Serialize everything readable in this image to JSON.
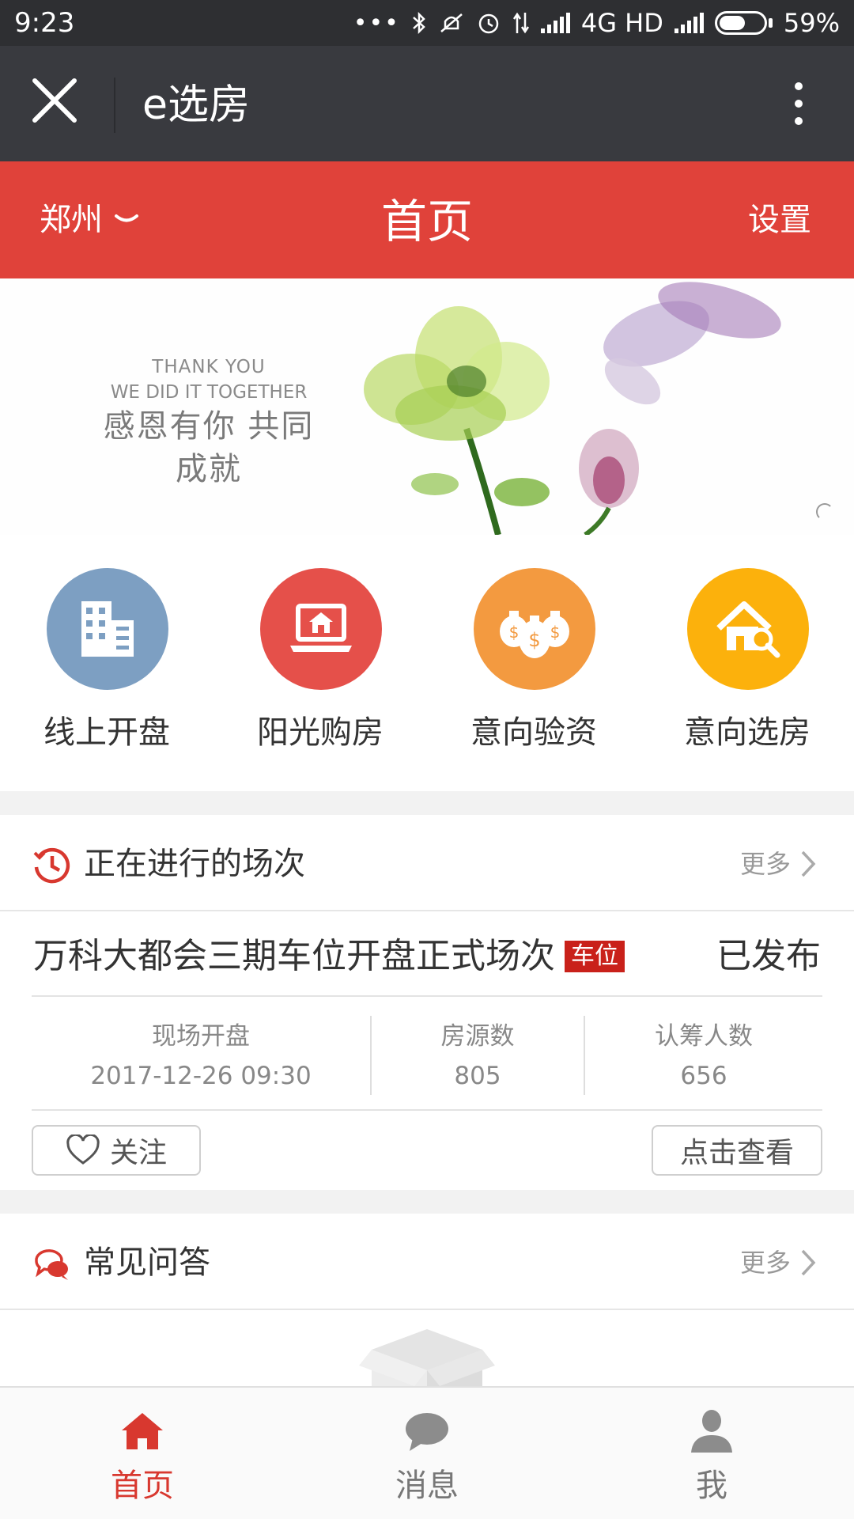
{
  "status_bar": {
    "time": "9:23",
    "network": "4G HD",
    "battery": "59%",
    "battery_level": 0.59,
    "icons": [
      "more-dots-icon",
      "bluetooth-icon",
      "mute-icon",
      "alarm-icon",
      "data-icon",
      "signal-icon",
      "signal-icon",
      "battery-icon"
    ]
  },
  "app_bar": {
    "title": "e选房",
    "icons": [
      "close-icon",
      "more-vertical-icon"
    ]
  },
  "header": {
    "city": "郑州",
    "title": "首页",
    "settings": "设置"
  },
  "banner": {
    "line1": "THANK YOU",
    "line2": "WE DID IT TOGETHER",
    "line3": "感恩有你  共同成就"
  },
  "actions": [
    {
      "label": "线上开盘",
      "icon": "building-icon",
      "color": "#7d9fc2"
    },
    {
      "label": "阳光购房",
      "icon": "laptop-house-icon",
      "color": "#e5504a"
    },
    {
      "label": "意向验资",
      "icon": "money-bags-icon",
      "color": "#f39a40"
    },
    {
      "label": "意向选房",
      "icon": "house-search-icon",
      "color": "#fcb10c"
    }
  ],
  "sessions": {
    "title": "正在进行的场次",
    "more": "更多",
    "card": {
      "name": "万科大都会三期车位开盘正式场次",
      "tag": "车位",
      "status": "已发布",
      "stats": [
        {
          "label": "现场开盘",
          "value": "2017-12-26 09:30"
        },
        {
          "label": "房源数",
          "value": "805"
        },
        {
          "label": "认筹人数",
          "value": "656"
        }
      ],
      "follow": "关注",
      "view": "点击查看"
    }
  },
  "faq": {
    "title": "常见问答",
    "more": "更多"
  },
  "tabs": [
    {
      "label": "首页",
      "icon": "home-icon",
      "active": true
    },
    {
      "label": "消息",
      "icon": "message-icon",
      "active": false
    },
    {
      "label": "我",
      "icon": "user-icon",
      "active": false
    }
  ],
  "colors": {
    "brand_red": "#e0423a",
    "tab_active": "#d8382f",
    "app_bar": "#393a3f",
    "tag": "#c9211a"
  }
}
